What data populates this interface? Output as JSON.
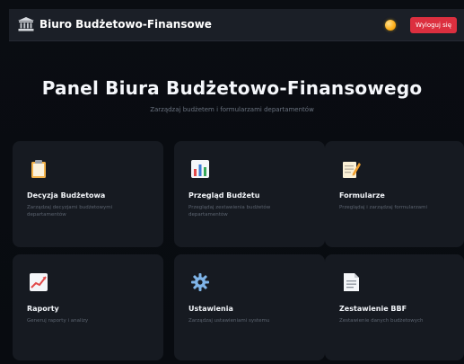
{
  "header": {
    "title": "Biuro Budżetowo-Finansowe",
    "logout_label": "Wyloguj się"
  },
  "hero": {
    "title": "Panel Biura Budżetowo-Finansowego",
    "subtitle": "Zarządzaj budżetem i formularzami departamentów"
  },
  "cards": [
    {
      "icon": "clipboard-icon",
      "title": "Decyzja Budżetowa",
      "description": "Zarządzaj decyzjami budżetowymi departamentów"
    },
    {
      "icon": "bar-chart-icon",
      "title": "Przegląd Budżetu",
      "description": "Przeglądaj zestawienia budżetów departamentów"
    },
    {
      "icon": "memo-icon",
      "title": "Formularze",
      "description": "Przeglądaj i zarządzaj formularzami"
    },
    {
      "icon": "trend-chart-icon",
      "title": "Raporty",
      "description": "Generuj raporty i analizy"
    },
    {
      "icon": "gear-icon",
      "title": "Ustawienia",
      "description": "Zarządzaj ustawieniami systemu"
    },
    {
      "icon": "document-icon",
      "title": "Zestawienie BBF",
      "description": "Zestawienie danych budżetowych"
    }
  ],
  "colors": {
    "background": "#080b10",
    "card": "#161a21",
    "topbar": "#1b1f27",
    "logout": "#dc2f3f",
    "status_dot": "#ffb11f"
  }
}
